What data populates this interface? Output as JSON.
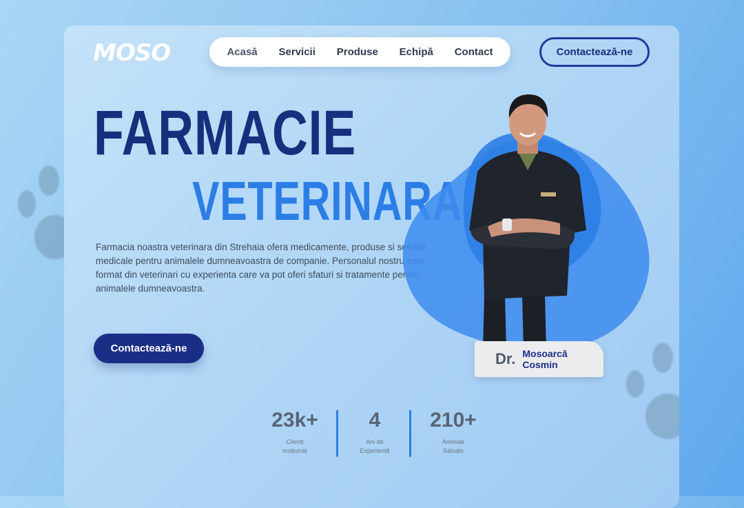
{
  "brand": {
    "logo": "MOSO"
  },
  "nav": {
    "items": [
      {
        "label": "Acasă"
      },
      {
        "label": "Servicii"
      },
      {
        "label": "Produse"
      },
      {
        "label": "Echipă"
      },
      {
        "label": "Contact"
      }
    ],
    "cta_label": "Contactează-ne"
  },
  "hero": {
    "title_line1": "FARMACIE",
    "title_line2": "VETERINARA",
    "description": "Farmacia noastra veterinara din Strehaia ofera medicamente, produse si servicii medicale pentru animalele dumneavoastra de companie. Personalul nostru este format din veterinari cu experienta care va pot oferi sfaturi si tratamente pentru animalele dumneavoastra.",
    "cta_label": "Contactează-ne"
  },
  "doctor": {
    "prefix": "Dr.",
    "first_line": "Mosoarcă",
    "second_line": "Cosmin"
  },
  "stats": [
    {
      "value": "23k+",
      "label_line1": "Clienți",
      "label_line2": "mulțumiți"
    },
    {
      "value": "4",
      "label_line1": "Ani de",
      "label_line2": "Experiență"
    },
    {
      "value": "210+",
      "label_line1": "Animale",
      "label_line2": "Salvate"
    }
  ],
  "colors": {
    "navy": "#1b2e86",
    "title_blue": "#15307d",
    "accent_blue": "#2c7ee6",
    "background": "#9fcaf3"
  },
  "icons": {
    "decor_left": "paw-print-icon",
    "decor_right": "paw-print-icon"
  }
}
